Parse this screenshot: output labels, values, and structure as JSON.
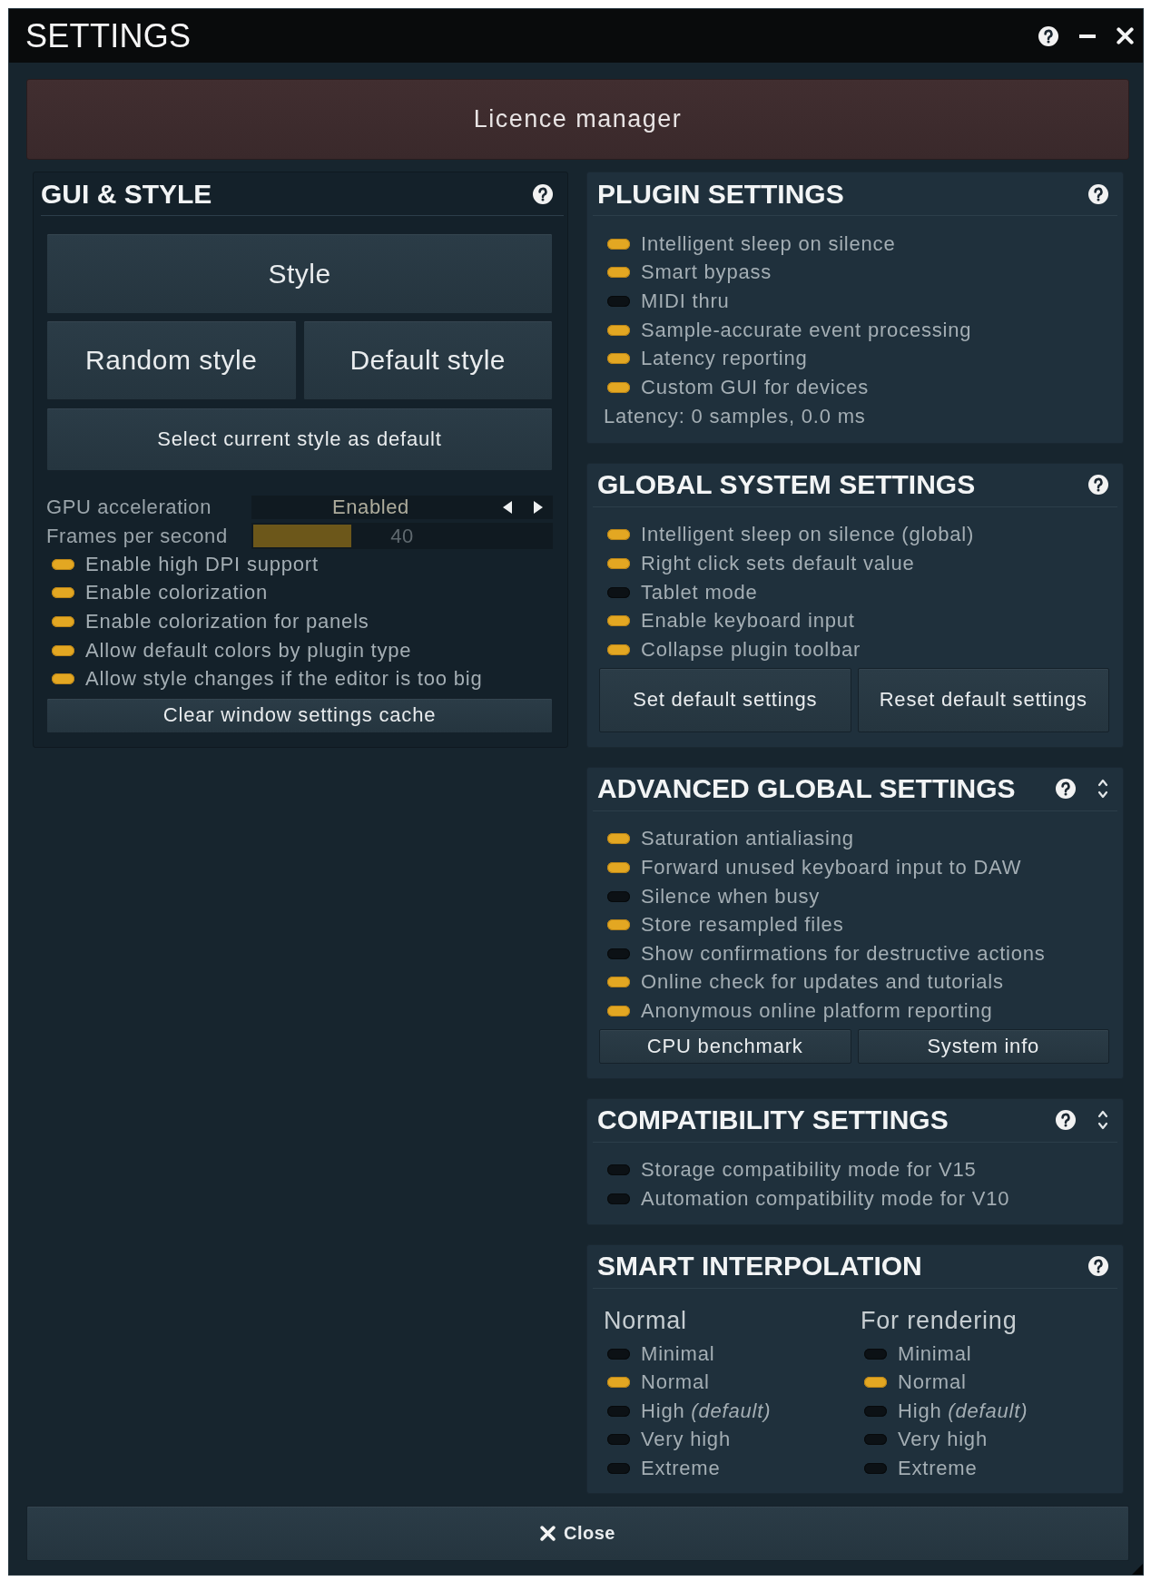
{
  "window": {
    "title": "SETTINGS"
  },
  "licence_manager": {
    "label": "Licence manager"
  },
  "gui_style": {
    "title": "GUI & STYLE",
    "style_button": {
      "label": "Style"
    },
    "style_buttons": [
      {
        "label": "Random style"
      },
      {
        "label": "Default style"
      }
    ],
    "select_default_button": {
      "label": "Select current style as default"
    },
    "gpu_acceleration": {
      "label": "GPU acceleration",
      "value": "Enabled"
    },
    "frames_per_second": {
      "label": "Frames per second",
      "reading": "40",
      "level": 0.33
    },
    "toggles": [
      {
        "label": "Enable high DPI support",
        "on": true
      },
      {
        "label": "Enable colorization",
        "on": true
      },
      {
        "label": "Enable colorization for panels",
        "on": true
      },
      {
        "label": "Allow default colors by plugin type",
        "on": true
      },
      {
        "label": "Allow style changes if the editor is too big",
        "on": true
      }
    ],
    "clear_cache_button": {
      "label": "Clear window settings cache"
    }
  },
  "panels": [
    {
      "kind": "toggles",
      "title": "PLUGIN SETTINGS",
      "toggles": [
        {
          "label": "Intelligent sleep on silence",
          "on": true
        },
        {
          "label": "Smart bypass",
          "on": true
        },
        {
          "label": "MIDI thru",
          "on": false
        },
        {
          "label": "Sample-accurate event processing",
          "on": true
        },
        {
          "label": "Latency reporting",
          "on": true
        },
        {
          "label": "Custom GUI for devices",
          "on": true
        }
      ],
      "status_text": "Latency: 0 samples, 0.0 ms"
    },
    {
      "kind": "toggles",
      "title": "GLOBAL SYSTEM SETTINGS",
      "toggles": [
        {
          "label": "Intelligent sleep on silence (global)",
          "on": true
        },
        {
          "label": "Right click sets default value",
          "on": true
        },
        {
          "label": "Tablet mode",
          "on": false
        },
        {
          "label": "Enable keyboard input",
          "on": true
        },
        {
          "label": "Collapse plugin toolbar",
          "on": true
        }
      ],
      "buttons": [
        {
          "label": "Set default settings"
        },
        {
          "label": "Reset default settings"
        }
      ]
    },
    {
      "kind": "toggles",
      "title": "ADVANCED GLOBAL SETTINGS",
      "collapsible": true,
      "toggles": [
        {
          "label": "Saturation antialiasing",
          "on": true
        },
        {
          "label": "Forward unused keyboard input to DAW",
          "on": true
        },
        {
          "label": "Silence when busy",
          "on": false
        },
        {
          "label": "Store resampled files",
          "on": true
        },
        {
          "label": "Show confirmations for destructive actions",
          "on": false
        },
        {
          "label": "Online check for updates and tutorials",
          "on": true
        },
        {
          "label": "Anonymous online platform reporting",
          "on": true
        }
      ],
      "buttons": [
        {
          "label": "CPU benchmark"
        },
        {
          "label": "System info"
        }
      ]
    },
    {
      "kind": "toggles",
      "title": "COMPATIBILITY SETTINGS",
      "collapsible": true,
      "toggles": [
        {
          "label": "Storage compatibility mode for V15",
          "on": false
        },
        {
          "label": "Automation compatibility mode for V10",
          "on": false
        }
      ]
    },
    {
      "kind": "choices",
      "title": "SMART INTERPOLATION",
      "columns": [
        {
          "heading": "Normal",
          "options": [
            {
              "label": "Minimal",
              "selected": false
            },
            {
              "label": "Normal",
              "selected": true
            },
            {
              "label": "High *(default)*",
              "selected": false
            },
            {
              "label": "Very high",
              "selected": false
            },
            {
              "label": "Extreme",
              "selected": false
            }
          ]
        },
        {
          "heading": "For rendering",
          "options": [
            {
              "label": "Minimal",
              "selected": false
            },
            {
              "label": "Normal",
              "selected": true
            },
            {
              "label": "High *(default)*",
              "selected": false
            },
            {
              "label": "Very high",
              "selected": false
            },
            {
              "label": "Extreme",
              "selected": false
            }
          ]
        }
      ]
    }
  ],
  "close_button": {
    "label": "Close"
  }
}
